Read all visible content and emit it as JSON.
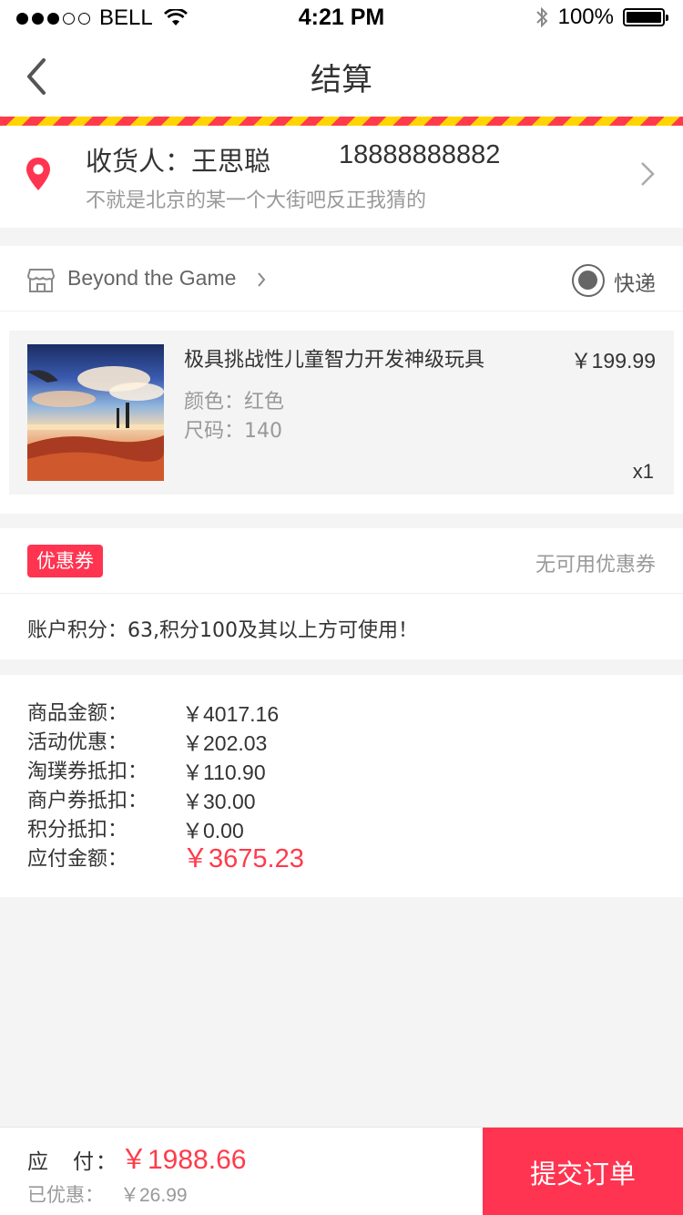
{
  "status_bar": {
    "carrier": "BELL",
    "time": "4:21 PM",
    "battery": "100%"
  },
  "nav": {
    "title": "结算"
  },
  "address": {
    "receiver_label": "收货人：",
    "receiver_name": "王思聪",
    "phone": "18888888882",
    "detail": "不就是北京的某一个大街吧反正我猜的"
  },
  "store": {
    "name": "Beyond the Game",
    "shipping": "快递"
  },
  "product": {
    "title": "极具挑战性儿童智力开发神级玩具",
    "price": "￥199.99",
    "color": "颜色：红色",
    "size": "尺码：140",
    "quantity": "x1"
  },
  "coupon": {
    "badge": "优惠券",
    "status": "无可用优惠券",
    "points": "账户积分：63,积分100及其以上方可使用！"
  },
  "summary": [
    {
      "label": "商品金额：",
      "value": "￥4017.16"
    },
    {
      "label": "活动优惠：",
      "value": "￥202.03"
    },
    {
      "label": "淘璞券抵扣：",
      "value": "￥110.90"
    },
    {
      "label": "商户券抵扣：",
      "value": "￥30.00"
    },
    {
      "label": "积分抵扣：",
      "value": "￥0.00"
    },
    {
      "label": "应付金额：",
      "value": "￥3675.23"
    }
  ],
  "bottom": {
    "pay_label": "应　付：",
    "pay_amount": "￥1988.66",
    "discount_label": "已优惠：",
    "discount_amount": "￥26.99",
    "submit": "提交订单"
  },
  "colors": {
    "accent": "#ff3450",
    "price_red": "#ff3b4b"
  }
}
